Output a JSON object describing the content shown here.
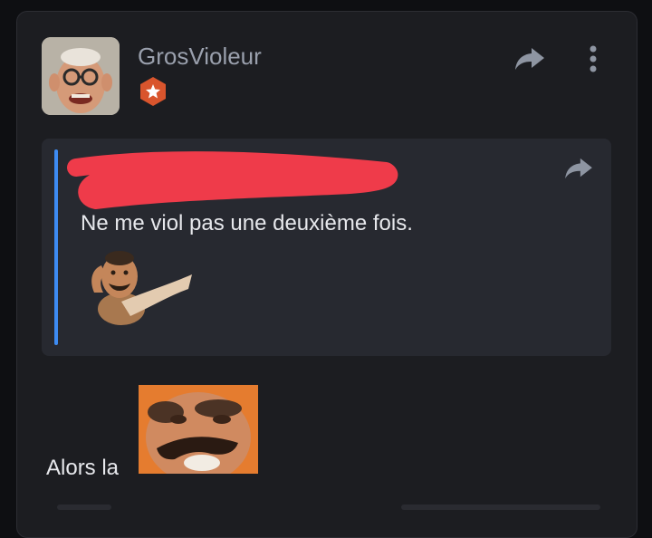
{
  "post": {
    "username": "GrosVioleur",
    "avatar_icon": "user-avatar",
    "rank_icon": "star-badge-icon",
    "share_icon": "share-icon",
    "more_icon": "more-vertical-icon",
    "quote": {
      "text": "Ne me viol pas une deuxième fois.",
      "author_redacted": true,
      "share_icon": "share-icon",
      "sticker_icon": "dancing-man-sticker"
    },
    "reply": {
      "text": "Alors la",
      "sticker_icon": "laughing-man-sticker"
    }
  },
  "colors": {
    "background": "#0e0f12",
    "card": "#1c1d21",
    "quote_bg": "#272930",
    "quote_bar": "#3d8bf2",
    "username": "#9aa0ad",
    "text": "#e7e8ec",
    "badge": "#d9552d",
    "redaction": "#ef3b4a"
  }
}
